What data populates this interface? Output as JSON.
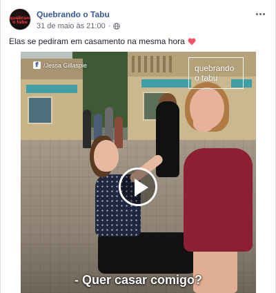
{
  "post": {
    "page_name": "Quebrando o Tabu",
    "avatar_text": "quebrando o tabu",
    "timestamp": "31 de maio às 21:00",
    "separator": "·",
    "privacy_icon": "globe-icon",
    "more_icon": "more-options-icon",
    "text": "Elas se pediram em casamento na mesma hora",
    "emoji_icon": "heart-icon",
    "heart_color": "#f25268"
  },
  "video": {
    "source_credit": "/Jessa Gillaspie",
    "source_icon": "facebook-icon",
    "logo_text": "quebrando o tabu",
    "play_icon": "play-icon",
    "caption": "- Quer casar comigo?"
  },
  "colors": {
    "link": "#385898",
    "meta": "#616770",
    "text": "#1d2129"
  }
}
